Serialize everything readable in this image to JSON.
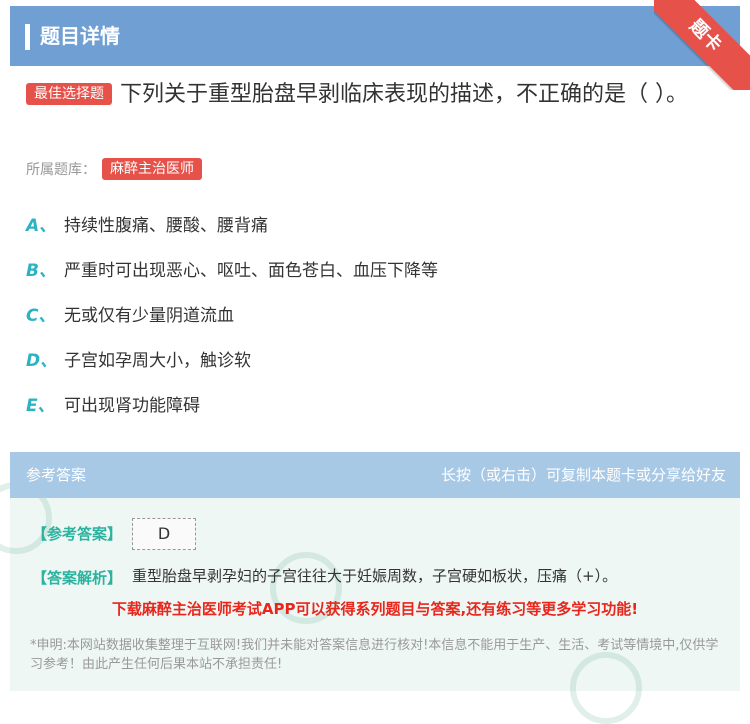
{
  "header": {
    "title": "题目详情",
    "ribbon": "题卡"
  },
  "question": {
    "type_badge": "最佳选择题",
    "text": "下列关于重型胎盘早剥临床表现的描述，不正确的是（ ）。",
    "bank_label": "所属题库：",
    "bank_name": "麻醉主治医师"
  },
  "options": [
    {
      "letter": "A、",
      "text": "持续性腹痛、腰酸、腰背痛"
    },
    {
      "letter": "B、",
      "text": "严重时可出现恶心、呕吐、面色苍白、血压下降等"
    },
    {
      "letter": "C、",
      "text": "无或仅有少量阴道流血"
    },
    {
      "letter": "D、",
      "text": "子宫如孕周大小，触诊软"
    },
    {
      "letter": "E、",
      "text": "可出现肾功能障碍"
    }
  ],
  "answer": {
    "section_title": "参考答案",
    "share_hint": "长按（或右击）可复制本题卡或分享给好友",
    "ref_label": "【参考答案】",
    "ref_value": "D",
    "analysis_label": "【答案解析】",
    "analysis_text": "重型胎盘早剥孕妇的子宫往往大于妊娠周数，子宫硬如板状，压痛（+）。",
    "promo": "下载麻醉主治医师考试APP可以获得系列题目与答案,还有练习等更多学习功能!",
    "notice": "*申明:本网站数据收集整理于互联网!我们并未能对答案信息进行核对!本信息不能用于生产、生活、考试等情境中,仅供学习参考！由此产生任何后果本站不承担责任!"
  },
  "colors": {
    "header": "#6f9fd3",
    "accent_red": "#e65149",
    "option_letter": "#2bb3c4",
    "answer_bg": "#eef7f3"
  }
}
